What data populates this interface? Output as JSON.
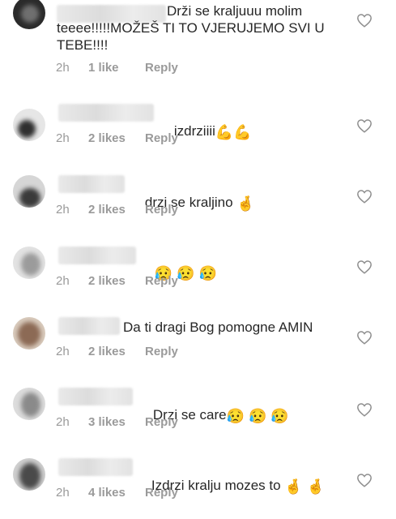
{
  "comments": [
    {
      "text": "Drži se kraljuuu molim teeee!!!!!MOŽEŠ TI TO VJERUJEMO SVI U TEBE!!!!",
      "time": "2h",
      "likes": "1 like",
      "reply": "Reply"
    },
    {
      "text": "izdrziiii",
      "emoji": "💪💪",
      "time": "2h",
      "likes": "2 likes",
      "reply": "Reply"
    },
    {
      "text": "drzi se kraljino",
      "emoji": "🤞",
      "time": "2h",
      "likes": "2 likes",
      "reply": "Reply"
    },
    {
      "text": "",
      "emoji": "😥 😥 😥",
      "time": "2h",
      "likes": "2 likes",
      "reply": "Reply"
    },
    {
      "text": "Da ti dragi Bog pomogne AMIN",
      "time": "2h",
      "likes": "2 likes",
      "reply": "Reply"
    },
    {
      "text": "Drzi se care",
      "emoji": "😥 😥 😥",
      "time": "2h",
      "likes": "3 likes",
      "reply": "Reply"
    },
    {
      "text": "Izdrzi kralju mozes to",
      "emoji": "🤞 🤞",
      "time": "2h",
      "likes": "4 likes",
      "reply": "Reply"
    }
  ],
  "colors": {
    "text": "#262626",
    "meta": "#9a9a9a",
    "heart": "#8e8e8e"
  },
  "icons": {
    "like": "heart-outline-icon"
  }
}
